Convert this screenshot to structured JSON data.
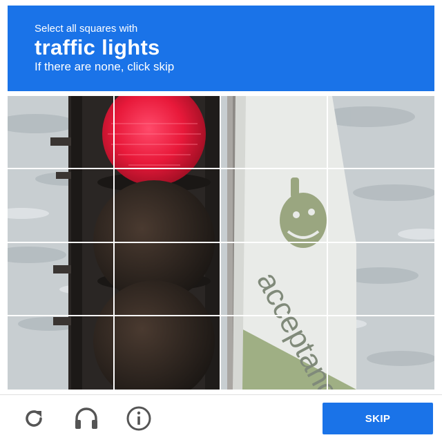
{
  "challenge": {
    "instruction_prefix": "Select all squares with",
    "target_object": "traffic lights",
    "instruction_suffix": "If there are none, click skip",
    "accent_color": "#1a73e8",
    "tiles": [
      {
        "row": 1,
        "col": 1
      },
      {
        "row": 1,
        "col": 2
      },
      {
        "row": 1,
        "col": 3
      },
      {
        "row": 1,
        "col": 4
      },
      {
        "row": 2,
        "col": 1
      },
      {
        "row": 2,
        "col": 2
      },
      {
        "row": 2,
        "col": 3
      },
      {
        "row": 2,
        "col": 4
      },
      {
        "row": 3,
        "col": 1
      },
      {
        "row": 3,
        "col": 2
      },
      {
        "row": 3,
        "col": 3
      },
      {
        "row": 3,
        "col": 4
      },
      {
        "row": 4,
        "col": 1
      },
      {
        "row": 4,
        "col": 2
      },
      {
        "row": 4,
        "col": 3
      },
      {
        "row": 4,
        "col": 4
      }
    ],
    "photo_sign_text": "acceptance"
  },
  "footer": {
    "reload_icon": "reload-icon",
    "audio_icon": "headphones-icon",
    "info_icon": "info-icon",
    "skip_label": "SKIP"
  }
}
